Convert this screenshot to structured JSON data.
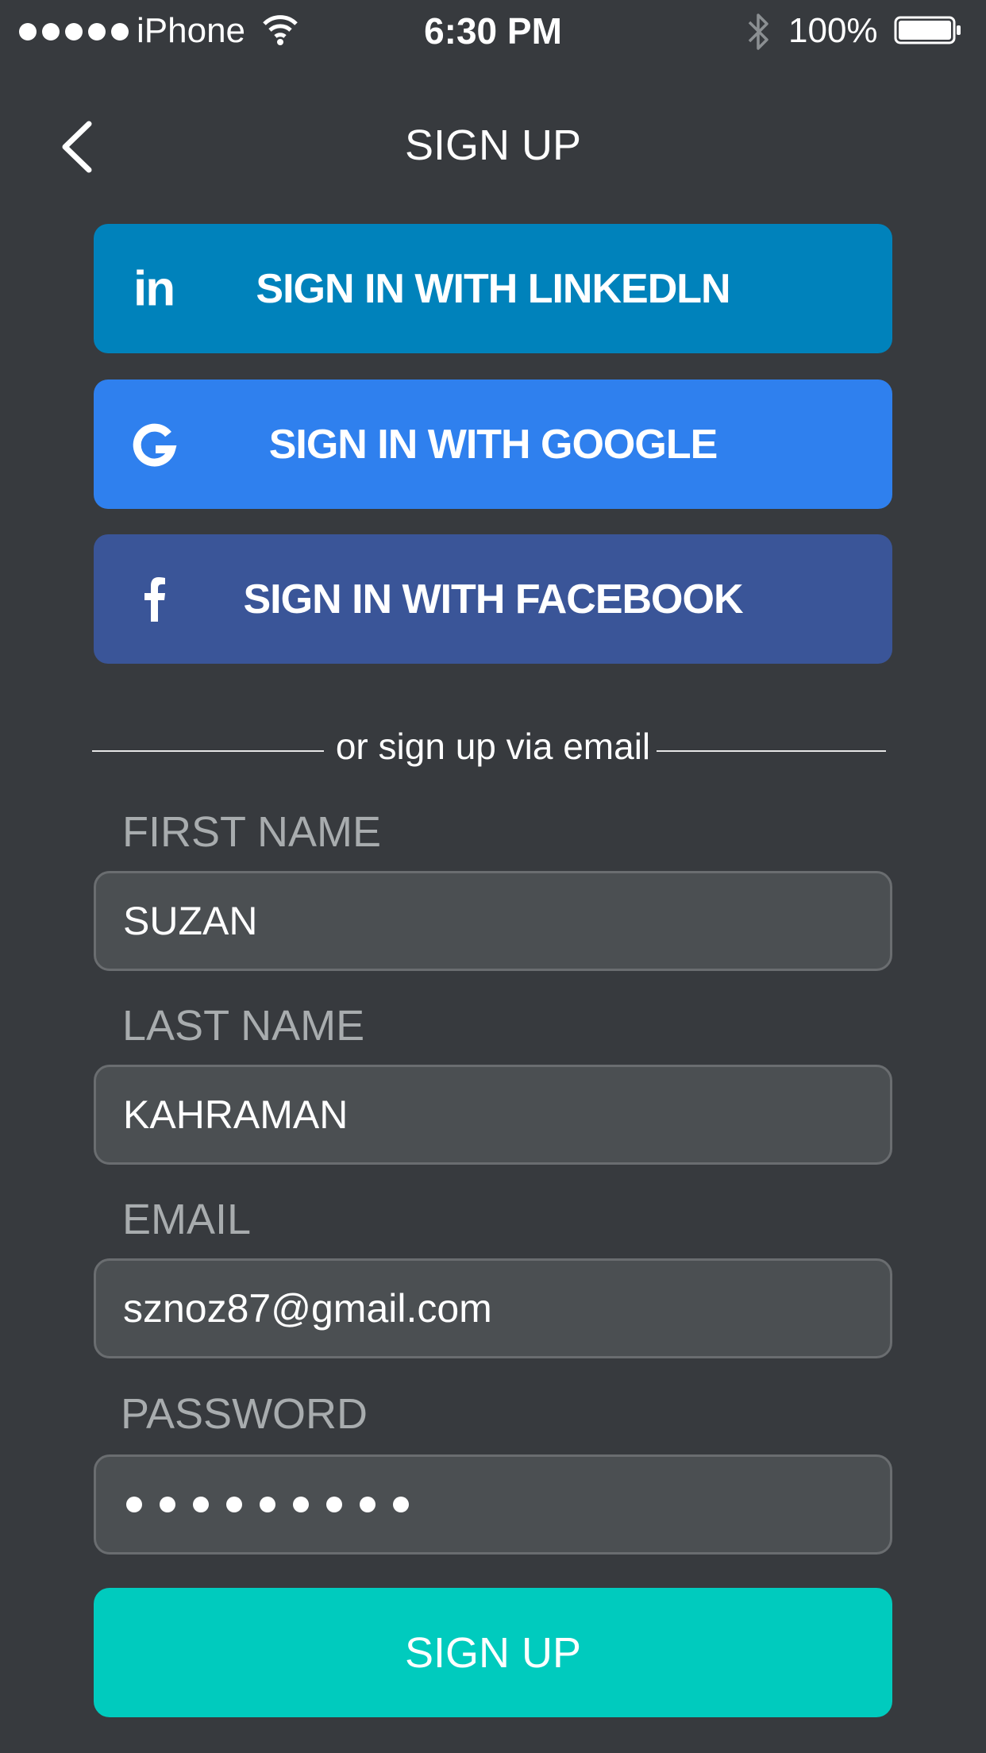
{
  "status_bar": {
    "carrier": "iPhone",
    "time": "6:30 PM",
    "battery_percent": "100%",
    "icons": [
      "signal-icon",
      "wifi-icon",
      "bluetooth-icon",
      "battery-icon"
    ]
  },
  "nav": {
    "title": "SIGN UP",
    "back_icon": "chevron-left-icon"
  },
  "social": {
    "linkedin": {
      "label": "SIGN IN WITH LINKEDLN",
      "icon": "linkedin-icon",
      "color": "#0082bb"
    },
    "google": {
      "label": "SIGN IN WITH GOOGLE",
      "icon": "google-icon",
      "color": "#2f80ee"
    },
    "facebook": {
      "label": "SIGN IN WITH FACEBOOK",
      "icon": "facebook-icon",
      "color": "#3a5598"
    }
  },
  "divider_text": "or sign up via email",
  "form": {
    "first_name": {
      "label": "FIRST NAME",
      "value": "SUZAN"
    },
    "last_name": {
      "label": "LAST NAME",
      "value": "KAHRAMAN"
    },
    "email": {
      "label": "EMAIL",
      "value": "sznoz87@gmail.com"
    },
    "password": {
      "label": "PASSWORD",
      "masked_length": 9
    }
  },
  "submit_label": "SIGN UP",
  "colors": {
    "background": "#373a3e",
    "accent": "#00cbbe",
    "field_bg": "#4b4f52",
    "label": "#a8acae"
  }
}
